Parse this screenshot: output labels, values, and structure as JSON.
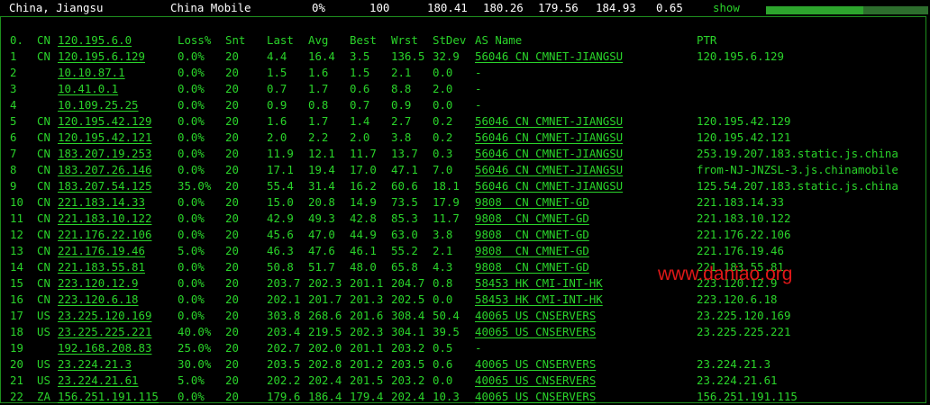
{
  "summary": {
    "location": "China, Jiangsu",
    "isp": "China Mobile",
    "loss": "0%",
    "sent": "100",
    "last": "180.41",
    "avg": "180.26",
    "best": "179.56",
    "worst": "184.93",
    "stdev": "0.65",
    "show_label": "show",
    "progress_fraction": 0.6
  },
  "headers": {
    "idx": "0.",
    "cc": "CN",
    "ip": "120.195.6.0",
    "loss": "Loss%",
    "snt": "Snt",
    "last": "Last",
    "avg": "Avg",
    "best": "Best",
    "wrst": "Wrst",
    "stdev": "StDev",
    "as": "AS Name",
    "ptr": "PTR"
  },
  "rows": [
    {
      "idx": "1",
      "cc": "CN",
      "ip": "120.195.6.129",
      "loss": "0.0%",
      "snt": "20",
      "last": "4.4",
      "avg": "16.4",
      "best": "3.5",
      "wrst": "136.5",
      "stdev": "32.9",
      "as": "56046 CN CMNET-JIANGSU",
      "ptr": "120.195.6.129"
    },
    {
      "idx": "2",
      "cc": "",
      "ip": "10.10.87.1",
      "loss": "0.0%",
      "snt": "20",
      "last": "1.5",
      "avg": "1.6",
      "best": "1.5",
      "wrst": "2.1",
      "stdev": "0.0",
      "as": "-",
      "ptr": ""
    },
    {
      "idx": "3",
      "cc": "",
      "ip": "10.41.0.1",
      "loss": "0.0%",
      "snt": "20",
      "last": "0.7",
      "avg": "1.7",
      "best": "0.6",
      "wrst": "8.8",
      "stdev": "2.0",
      "as": "-",
      "ptr": ""
    },
    {
      "idx": "4",
      "cc": "",
      "ip": "10.109.25.25",
      "loss": "0.0%",
      "snt": "20",
      "last": "0.9",
      "avg": "0.8",
      "best": "0.7",
      "wrst": "0.9",
      "stdev": "0.0",
      "as": "-",
      "ptr": ""
    },
    {
      "idx": "5",
      "cc": "CN",
      "ip": "120.195.42.129",
      "loss": "0.0%",
      "snt": "20",
      "last": "1.6",
      "avg": "1.7",
      "best": "1.4",
      "wrst": "2.7",
      "stdev": "0.2",
      "as": "56046 CN CMNET-JIANGSU",
      "ptr": "120.195.42.129"
    },
    {
      "idx": "6",
      "cc": "CN",
      "ip": "120.195.42.121",
      "loss": "0.0%",
      "snt": "20",
      "last": "2.0",
      "avg": "2.2",
      "best": "2.0",
      "wrst": "3.8",
      "stdev": "0.2",
      "as": "56046 CN CMNET-JIANGSU",
      "ptr": "120.195.42.121"
    },
    {
      "idx": "7",
      "cc": "CN",
      "ip": "183.207.19.253",
      "loss": "0.0%",
      "snt": "20",
      "last": "11.9",
      "avg": "12.1",
      "best": "11.7",
      "wrst": "13.7",
      "stdev": "0.3",
      "as": "56046 CN CMNET-JIANGSU",
      "ptr": "253.19.207.183.static.js.china"
    },
    {
      "idx": "8",
      "cc": "CN",
      "ip": "183.207.26.146",
      "loss": "0.0%",
      "snt": "20",
      "last": "17.1",
      "avg": "19.4",
      "best": "17.0",
      "wrst": "47.1",
      "stdev": "7.0",
      "as": "56046 CN CMNET-JIANGSU",
      "ptr": "from-NJ-JNZSL-3.js.chinamobile"
    },
    {
      "idx": "9",
      "cc": "CN",
      "ip": "183.207.54.125",
      "loss": "35.0%",
      "snt": "20",
      "last": "55.4",
      "avg": "31.4",
      "best": "16.2",
      "wrst": "60.6",
      "stdev": "18.1",
      "as": "56046 CN CMNET-JIANGSU",
      "ptr": "125.54.207.183.static.js.china"
    },
    {
      "idx": "10",
      "cc": "CN",
      "ip": "221.183.14.33",
      "loss": "0.0%",
      "snt": "20",
      "last": "15.0",
      "avg": "20.8",
      "best": "14.9",
      "wrst": "73.5",
      "stdev": "17.9",
      "as": "9808  CN CMNET-GD",
      "ptr": "221.183.14.33"
    },
    {
      "idx": "11",
      "cc": "CN",
      "ip": "221.183.10.122",
      "loss": "0.0%",
      "snt": "20",
      "last": "42.9",
      "avg": "49.3",
      "best": "42.8",
      "wrst": "85.3",
      "stdev": "11.7",
      "as": "9808  CN CMNET-GD",
      "ptr": "221.183.10.122"
    },
    {
      "idx": "12",
      "cc": "CN",
      "ip": "221.176.22.106",
      "loss": "0.0%",
      "snt": "20",
      "last": "45.6",
      "avg": "47.0",
      "best": "44.9",
      "wrst": "63.0",
      "stdev": "3.8",
      "as": "9808  CN CMNET-GD",
      "ptr": "221.176.22.106"
    },
    {
      "idx": "13",
      "cc": "CN",
      "ip": "221.176.19.46",
      "loss": "5.0%",
      "snt": "20",
      "last": "46.3",
      "avg": "47.6",
      "best": "46.1",
      "wrst": "55.2",
      "stdev": "2.1",
      "as": "9808  CN CMNET-GD",
      "ptr": "221.176.19.46"
    },
    {
      "idx": "14",
      "cc": "CN",
      "ip": "221.183.55.81",
      "loss": "0.0%",
      "snt": "20",
      "last": "50.8",
      "avg": "51.7",
      "best": "48.0",
      "wrst": "65.8",
      "stdev": "4.3",
      "as": "9808  CN CMNET-GD",
      "ptr": "221.183.55.81"
    },
    {
      "idx": "15",
      "cc": "CN",
      "ip": "223.120.12.9",
      "loss": "0.0%",
      "snt": "20",
      "last": "203.7",
      "avg": "202.3",
      "best": "201.1",
      "wrst": "204.7",
      "stdev": "0.8",
      "as": "58453 HK CMI-INT-HK",
      "ptr": "223.120.12.9"
    },
    {
      "idx": "16",
      "cc": "CN",
      "ip": "223.120.6.18",
      "loss": "0.0%",
      "snt": "20",
      "last": "202.1",
      "avg": "201.7",
      "best": "201.3",
      "wrst": "202.5",
      "stdev": "0.0",
      "as": "58453 HK CMI-INT-HK",
      "ptr": "223.120.6.18"
    },
    {
      "idx": "17",
      "cc": "US",
      "ip": "23.225.120.169",
      "loss": "0.0%",
      "snt": "20",
      "last": "303.8",
      "avg": "268.6",
      "best": "201.6",
      "wrst": "308.4",
      "stdev": "50.4",
      "as": "40065 US CNSERVERS",
      "ptr": "23.225.120.169"
    },
    {
      "idx": "18",
      "cc": "US",
      "ip": "23.225.225.221",
      "loss": "40.0%",
      "snt": "20",
      "last": "203.4",
      "avg": "219.5",
      "best": "202.3",
      "wrst": "304.1",
      "stdev": "39.5",
      "as": "40065 US CNSERVERS",
      "ptr": "23.225.225.221"
    },
    {
      "idx": "19",
      "cc": "",
      "ip": "192.168.208.83",
      "loss": "25.0%",
      "snt": "20",
      "last": "202.7",
      "avg": "202.0",
      "best": "201.1",
      "wrst": "203.2",
      "stdev": "0.5",
      "as": "-",
      "ptr": ""
    },
    {
      "idx": "20",
      "cc": "US",
      "ip": "23.224.21.3",
      "loss": "30.0%",
      "snt": "20",
      "last": "203.5",
      "avg": "202.8",
      "best": "201.2",
      "wrst": "203.5",
      "stdev": "0.6",
      "as": "40065 US CNSERVERS",
      "ptr": "23.224.21.3"
    },
    {
      "idx": "21",
      "cc": "US",
      "ip": "23.224.21.61",
      "loss": "5.0%",
      "snt": "20",
      "last": "202.2",
      "avg": "202.4",
      "best": "201.5",
      "wrst": "203.2",
      "stdev": "0.0",
      "as": "40065 US CNSERVERS",
      "ptr": "23.224.21.61"
    },
    {
      "idx": "22",
      "cc": "ZA",
      "ip": "156.251.191.115",
      "loss": "0.0%",
      "snt": "20",
      "last": "179.6",
      "avg": "186.4",
      "best": "179.4",
      "wrst": "202.4",
      "stdev": "10.3",
      "as": "40065 US CNSERVERS",
      "ptr": "156.251.191.115"
    }
  ],
  "watermark": "www.daniao.org",
  "colors": {
    "text": "#2ad42a",
    "header_text": "#ffffff",
    "background": "#000000",
    "watermark": "#e01818"
  }
}
